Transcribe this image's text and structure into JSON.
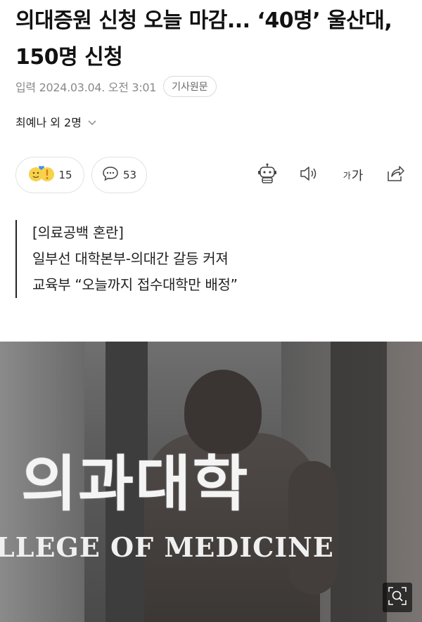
{
  "article": {
    "headline": "의대증원 신청 오늘 마감... ‘40명’ 울산대, 150명 신청",
    "date": "입력 2024.03.04. 오전 3:01",
    "original_button": "기사원문",
    "author": "최예나 외 2명"
  },
  "reactions": {
    "reaction_count": "15",
    "comment_count": "53"
  },
  "toolbar": {
    "font_small": "가",
    "font_large": "가"
  },
  "summary": {
    "lines": [
      "[의료공백 혼란]",
      "일부선 대학본부-의대간 갈등 커져",
      "교육부 “오늘까지 접수대학만 배정”"
    ]
  },
  "photo": {
    "sign_korean": "의과대학",
    "sign_english": "LLEGE OF MEDICINE"
  }
}
